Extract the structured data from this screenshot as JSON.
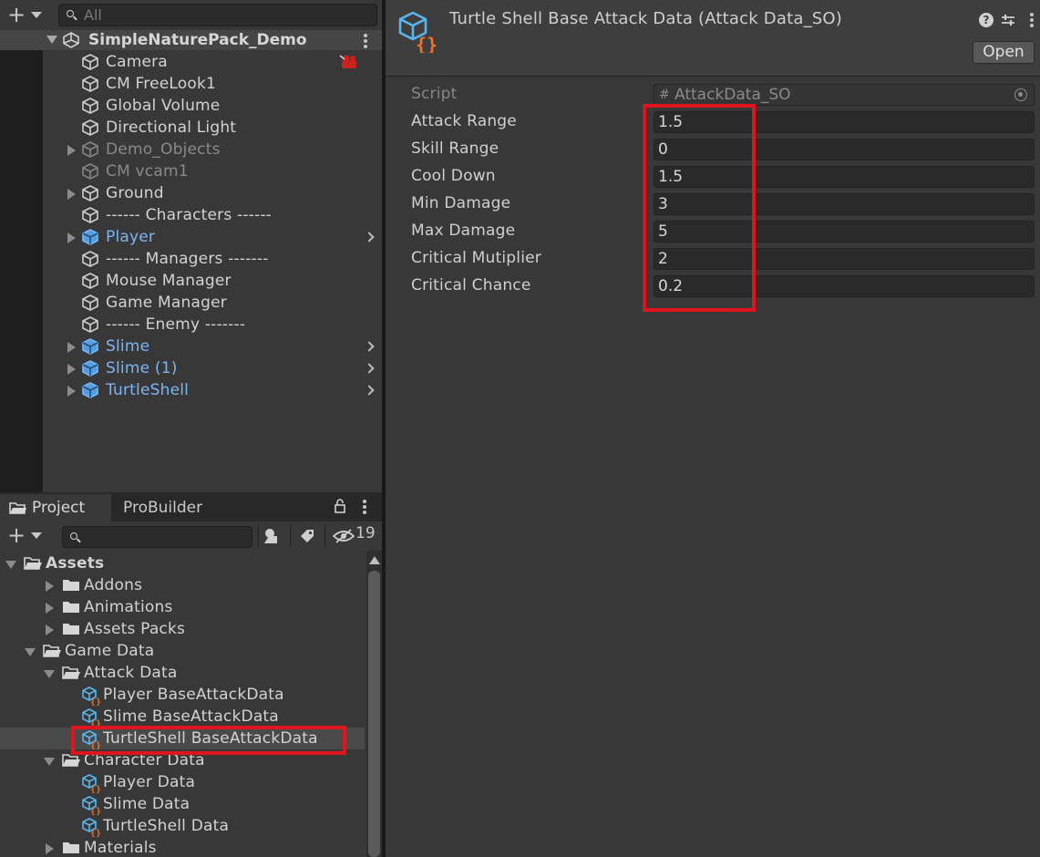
{
  "hierarchy": {
    "search_placeholder": "All",
    "scene_name": "SimpleNaturePack_Demo",
    "items": [
      {
        "label": "Camera",
        "type": "object"
      },
      {
        "label": "CM FreeLook1",
        "type": "object"
      },
      {
        "label": "Global Volume",
        "type": "object"
      },
      {
        "label": "Directional Light",
        "type": "object"
      },
      {
        "label": "Demo_Objects",
        "type": "object-disabled"
      },
      {
        "label": "CM vcam1",
        "type": "object-disabled"
      },
      {
        "label": "Ground",
        "type": "object"
      },
      {
        "label": "------ Characters ------",
        "type": "object"
      },
      {
        "label": "Player",
        "type": "prefab"
      },
      {
        "label": "------ Managers -------",
        "type": "object"
      },
      {
        "label": "Mouse Manager",
        "type": "object"
      },
      {
        "label": "Game Manager",
        "type": "object"
      },
      {
        "label": "------ Enemy -------",
        "type": "object"
      },
      {
        "label": "Slime",
        "type": "prefab"
      },
      {
        "label": "Slime (1)",
        "type": "prefab"
      },
      {
        "label": "TurtleShell",
        "type": "prefab"
      }
    ]
  },
  "project": {
    "tabs": [
      "Project",
      "ProBuilder"
    ],
    "hidden_count": "19",
    "tree": [
      {
        "label": "Assets",
        "kind": "folder-open"
      },
      {
        "label": "Addons",
        "kind": "folder"
      },
      {
        "label": "Animations",
        "kind": "folder"
      },
      {
        "label": "Assets Packs",
        "kind": "folder"
      },
      {
        "label": "Game Data",
        "kind": "folder-open"
      },
      {
        "label": "Attack Data",
        "kind": "folder-open"
      },
      {
        "label": "Player BaseAttackData",
        "kind": "asset"
      },
      {
        "label": "Slime BaseAttackData",
        "kind": "asset"
      },
      {
        "label": "TurtleShell BaseAttackData",
        "kind": "asset"
      },
      {
        "label": "Character Data",
        "kind": "folder-open"
      },
      {
        "label": "Player Data",
        "kind": "asset"
      },
      {
        "label": "Slime Data",
        "kind": "asset"
      },
      {
        "label": "TurtleShell Data",
        "kind": "asset"
      },
      {
        "label": "Materials",
        "kind": "folder"
      }
    ]
  },
  "inspector": {
    "title": "Turtle Shell Base Attack Data (Attack Data_SO)",
    "open_label": "Open",
    "help_glyph": "?",
    "script": {
      "label": "Script",
      "value": "AttackData_SO"
    },
    "properties": [
      {
        "label": "Attack Range",
        "value": "1.5"
      },
      {
        "label": "Skill Range",
        "value": "0"
      },
      {
        "label": "Cool Down",
        "value": "1.5"
      },
      {
        "label": "Min Damage",
        "value": "3"
      },
      {
        "label": "Max Damage",
        "value": "5"
      },
      {
        "label": "Critical Mutiplier",
        "value": "2"
      },
      {
        "label": "Critical Chance",
        "value": "0.2"
      }
    ]
  },
  "colors": {
    "prefab_text": "#7db4f2",
    "highlight": "#e0141c",
    "asset_icon_blue": "#59b7ef",
    "asset_icon_orange": "#f0702a"
  }
}
